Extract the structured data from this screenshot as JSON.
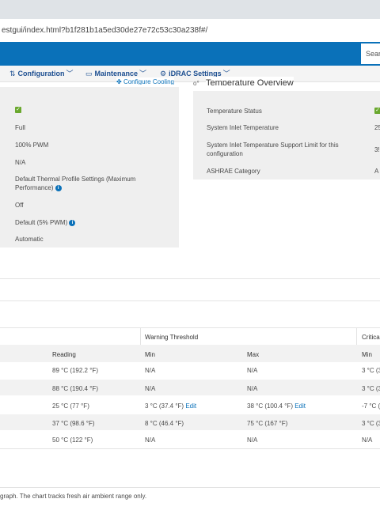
{
  "browser": {
    "url": "estgui/index.html?b1f281b1a5ed30de27e72c53c30a238f#/"
  },
  "header": {
    "search_placeholder": "Sear"
  },
  "nav": {
    "configuration": "Configuration",
    "maintenance": "Maintenance",
    "idrac_settings": "iDRAC Settings"
  },
  "cooling": {
    "configure_link": "Configure Cooling",
    "values": {
      "mode": "Full",
      "pwm": "100% PWM",
      "na": "N/A",
      "thermal_profile": "Default Thermal Profile Settings (Maximum Performance)",
      "off": "Off",
      "min_pwm": "Default (5% PWM)",
      "automatic": "Automatic"
    }
  },
  "temperature_overview": {
    "title": "Temperature Overview",
    "rows": [
      {
        "label": "Temperature Status",
        "value": ""
      },
      {
        "label": "System Inlet Temperature",
        "value": "25"
      },
      {
        "label": "System Inlet Temperature Support Limit for this configuration",
        "value": "3!"
      },
      {
        "label": "ASHRAE Category",
        "value": "A"
      }
    ]
  },
  "table": {
    "warning_header": "Warning Threshold",
    "critical_header": "Critica",
    "col_reading": "Reading",
    "col_min": "Min",
    "col_max": "Max",
    "col_crit_min": "Min",
    "edit_label": "Edit",
    "rows": [
      {
        "reading": "89 °C (192.2 °F)",
        "warn_min": "N/A",
        "warn_max": "N/A",
        "crit_min": "3 °C (3"
      },
      {
        "reading": "88 °C (190.4 °F)",
        "warn_min": "N/A",
        "warn_max": "N/A",
        "crit_min": "3 °C (3"
      },
      {
        "reading": "25 °C (77 °F)",
        "warn_min": "3 °C (37.4 °F)",
        "warn_max": "38 °C (100.4 °F)",
        "crit_min": "-7 °C ("
      },
      {
        "reading": "37 °C (98.6 °F)",
        "warn_min": "8 °C (46.4 °F)",
        "warn_max": "75 °C (167 °F)",
        "crit_min": "3 °C (3"
      },
      {
        "reading": "50 °C (122 °F)",
        "warn_min": "N/A",
        "warn_max": "N/A",
        "crit_min": "N/A"
      }
    ]
  },
  "footnote": "graph. The chart tracks fresh air ambient range only.",
  "colors": {
    "brand_blue": "#0a71b9",
    "status_green": "#6aa82e",
    "nav_text": "#1d4f91"
  }
}
